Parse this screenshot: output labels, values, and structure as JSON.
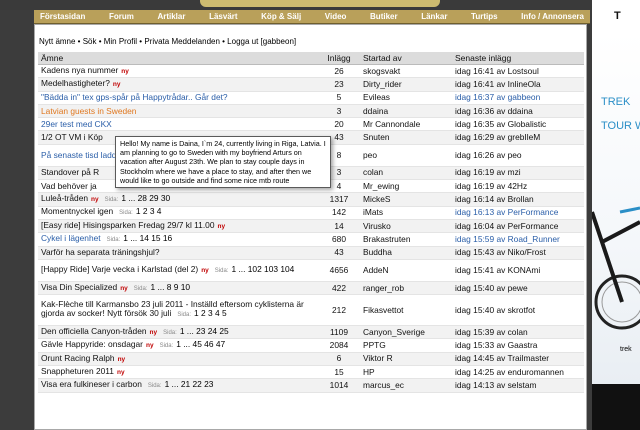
{
  "nav": [
    "Förstasidan",
    "Forum",
    "Artiklar",
    "Läsvärt",
    "Köp & Sälj",
    "Video",
    "Butiker",
    "Länkar",
    "Turtips",
    "Info / Annonsera"
  ],
  "userbar": "Nytt ämne • Sök • Min Profil • Privata Meddelanden • Logga ut [gabbeon]",
  "columns": {
    "topic": "Ämne",
    "posts": "Inlägg",
    "by": "Startad av",
    "last": "Senaste inlägg"
  },
  "ny_label": "ny",
  "sida_label": "Sida:",
  "rows": [
    {
      "title": "Kadens nya nummer",
      "ny": true,
      "pages": "",
      "posts": "26",
      "by": "skogsvakt",
      "last": "idag 16:41 av Lostsoul",
      "style": ""
    },
    {
      "title": "Medelhastigheter?",
      "ny": true,
      "pages": "",
      "posts": "23",
      "by": "Dirty_rider",
      "last": "idag 16:41 av InlineOla",
      "style": ""
    },
    {
      "title": "\"Bädda in\" tex gps-spår på Happytrådar.. Går det?",
      "ny": false,
      "pages": "",
      "posts": "5",
      "by": "Evileas",
      "last": "idag 16:37 av gabbeon",
      "style": "blue",
      "lastblue": true
    },
    {
      "title": "Latvian guests in Sweden",
      "ny": false,
      "pages": "",
      "posts": "3",
      "by": "ddaina",
      "last": "idag 16:36 av ddaina",
      "style": "orange"
    },
    {
      "title": "29er test med CKX",
      "ny": false,
      "pages": "",
      "posts": "20",
      "by": "Mr Cannondale",
      "last": "idag 16:35 av Globalistic",
      "style": "blue"
    },
    {
      "title": "1/2 OT VM i Köp",
      "ny": false,
      "pages": "",
      "posts": "43",
      "by": "Snuten",
      "last": "idag 16:29 av grebIleM",
      "style": ""
    },
    {
      "title": "På senaste tisd laddades upp a",
      "ny": false,
      "pages": "",
      "posts": "8",
      "by": "peo",
      "last": "idag 16:26 av peo",
      "style": "blue",
      "dbl": true
    },
    {
      "title": "Standover på R",
      "ny": false,
      "pages": "",
      "posts": "3",
      "by": "colan",
      "last": "idag 16:19 av mzi",
      "style": ""
    },
    {
      "title": "Vad behöver ja",
      "ny": false,
      "pages": "",
      "posts": "4",
      "by": "Mr_ewing",
      "last": "idag 16:19 av 42Hz",
      "style": ""
    },
    {
      "title": "Luleå-tråden",
      "ny": true,
      "pages": "1 ... 28 29 30",
      "posts": "1317",
      "by": "MickeS",
      "last": "idag 16:14 av Brollan",
      "style": ""
    },
    {
      "title": "Momentnyckel igen",
      "ny": false,
      "pages": "1 2 3 4",
      "posts": "142",
      "by": "iMats",
      "last": "idag 16:13 av PerFormance",
      "style": "",
      "lastblue": true
    },
    {
      "title": "[Easy ride] Hisingsparken Fredag 29/7 kl 11.00",
      "ny": true,
      "pages": "",
      "posts": "14",
      "by": "Virusko",
      "last": "idag 16:04 av PerFormance",
      "style": ""
    },
    {
      "title": "Cykel i lägenhet",
      "ny": false,
      "pages": "1 ... 14 15 16",
      "posts": "680",
      "by": "Brakastruten",
      "last": "idag 15:59 av Road_Runner",
      "style": "blue",
      "lastblue": true
    },
    {
      "title": "Varför ha separata träningshjul?",
      "ny": false,
      "pages": "",
      "posts": "43",
      "by": "Buddha",
      "last": "idag 15:43 av Niko/Frost",
      "style": ""
    },
    {
      "title": "[Happy Ride] Varje vecka i Karlstad (del 2)",
      "ny": true,
      "pages": "1 ... 102 103 104",
      "posts": "4656",
      "by": "AddeN",
      "last": "idag 15:41 av KONAmi",
      "style": "",
      "dbl": true
    },
    {
      "title": "Visa Din Specialized",
      "ny": true,
      "pages": "1 ... 8 9 10",
      "posts": "422",
      "by": "ranger_rob",
      "last": "idag 15:40 av pewe",
      "style": ""
    },
    {
      "title": "Kak-Flèche till Karmansbo 23 juli 2011 - Inställd eftersom cyklisterna är gjorda av socker! Nytt försök 30 juli",
      "ny": false,
      "pages": "1 2 3 4 5",
      "posts": "212",
      "by": "Fikasvettot",
      "last": "idag 15:40 av skrotfot",
      "style": "",
      "dbl": true,
      "tall": true
    },
    {
      "title": "Den officiella Canyon-tråden",
      "ny": true,
      "pages": "1 ... 23 24 25",
      "posts": "1109",
      "by": "Canyon_Sverige",
      "last": "idag 15:39 av colan",
      "style": ""
    },
    {
      "title": "Gävle Happyride: onsdagar",
      "ny": true,
      "pages": "1 ... 45 46 47",
      "posts": "2084",
      "by": "PPTG",
      "last": "idag 15:33 av Gaastra",
      "style": ""
    },
    {
      "title": "Orunt Racing Ralph",
      "ny": true,
      "pages": "",
      "posts": "6",
      "by": "Viktor R",
      "last": "idag 14:45 av Trailmaster",
      "style": ""
    },
    {
      "title": "Snappheturen 2011",
      "ny": true,
      "pages": "",
      "posts": "15",
      "by": "HP",
      "last": "idag 14:25 av enduromannen",
      "style": ""
    },
    {
      "title": "Visa era fulkineser i carbon",
      "ny": false,
      "pages": "1 ... 21 22 23",
      "posts": "1014",
      "by": "marcus_ec",
      "last": "idag 14:13 av selstam",
      "style": ""
    }
  ],
  "tooltip": "Hello! My name is Daina, I`m 24, currently living in Riga, Latvia. I am planning to go to Sweden with my boyfriend Arturs on vacation after August 23th. We plan to stay couple days in Stockholm where we have a place to stay, and after then we would like to go outside and find some nice mtb route",
  "ad": {
    "top": "T",
    "line1": "TREK",
    "line2": "TOUR W",
    "small": "trek",
    "accent": "#2b8fc7"
  }
}
